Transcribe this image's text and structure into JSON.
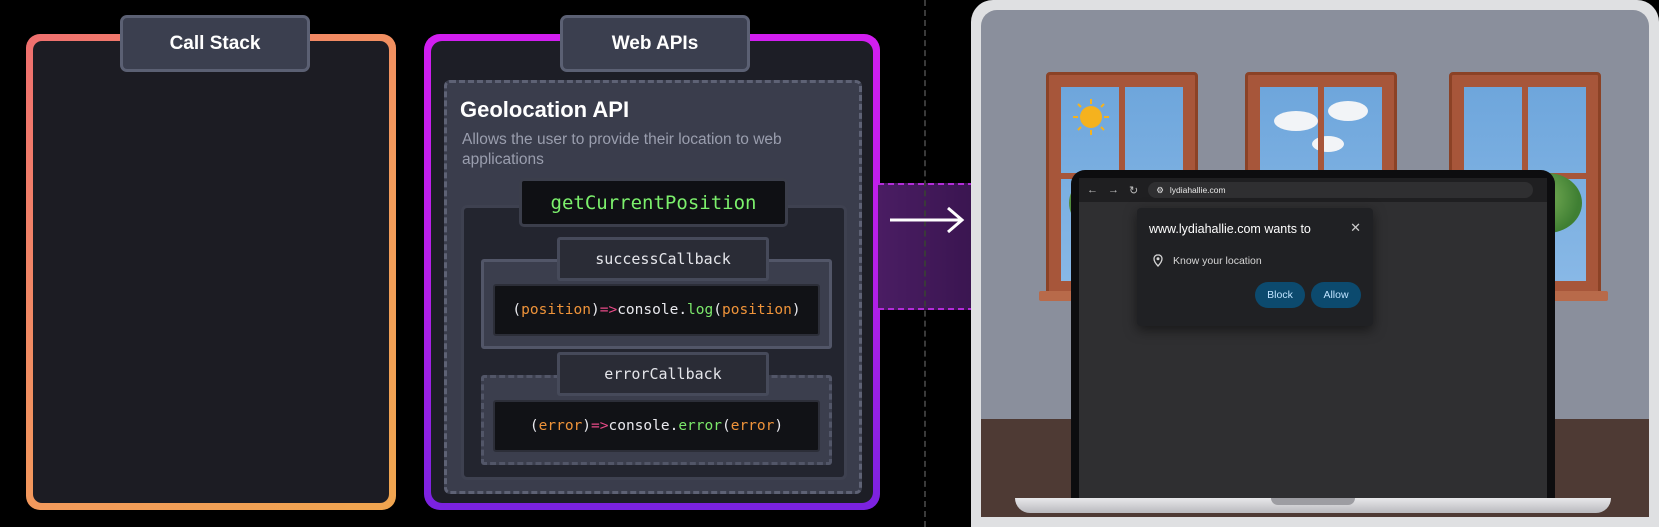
{
  "call_stack": {
    "title": "Call Stack"
  },
  "web_apis": {
    "title": "Web APIs",
    "api_name": "Geolocation API",
    "api_description": "Allows the user to provide their location to web applications",
    "method": "getCurrentPosition",
    "success": {
      "label": "successCallback",
      "code": {
        "open": "(",
        "param": "position",
        "close_param": ")",
        "arrow": "=>",
        "obj": "console",
        "dot": ".",
        "method": "log",
        "open2": "(",
        "arg": "position",
        "close2": ")"
      }
    },
    "error": {
      "label": "errorCallback",
      "code": {
        "open": "(",
        "param": "error",
        "close_param": ")",
        "arrow": "=>",
        "obj": "console",
        "dot": ".",
        "method": "error",
        "open2": "(",
        "arg": "error",
        "close2": ")"
      }
    }
  },
  "browser": {
    "url": "lydiahallie.com",
    "nav": {
      "back": "←",
      "forward": "→",
      "reload": "↻"
    },
    "permission_popup": {
      "title": "www.lydiahallie.com wants to",
      "close": "✕",
      "permission": "Know your location",
      "block_label": "Block",
      "allow_label": "Allow"
    }
  },
  "colors": {
    "call_stack_gradient": [
      "#ef6f6f",
      "#f0a54f"
    ],
    "web_apis_gradient": [
      "#d21ef0",
      "#7a22e0"
    ],
    "method_text": "#7cf06c",
    "param_text": "#f0943a",
    "arrow_text": "#e84a87",
    "button_bg": "#0c4a6e"
  }
}
